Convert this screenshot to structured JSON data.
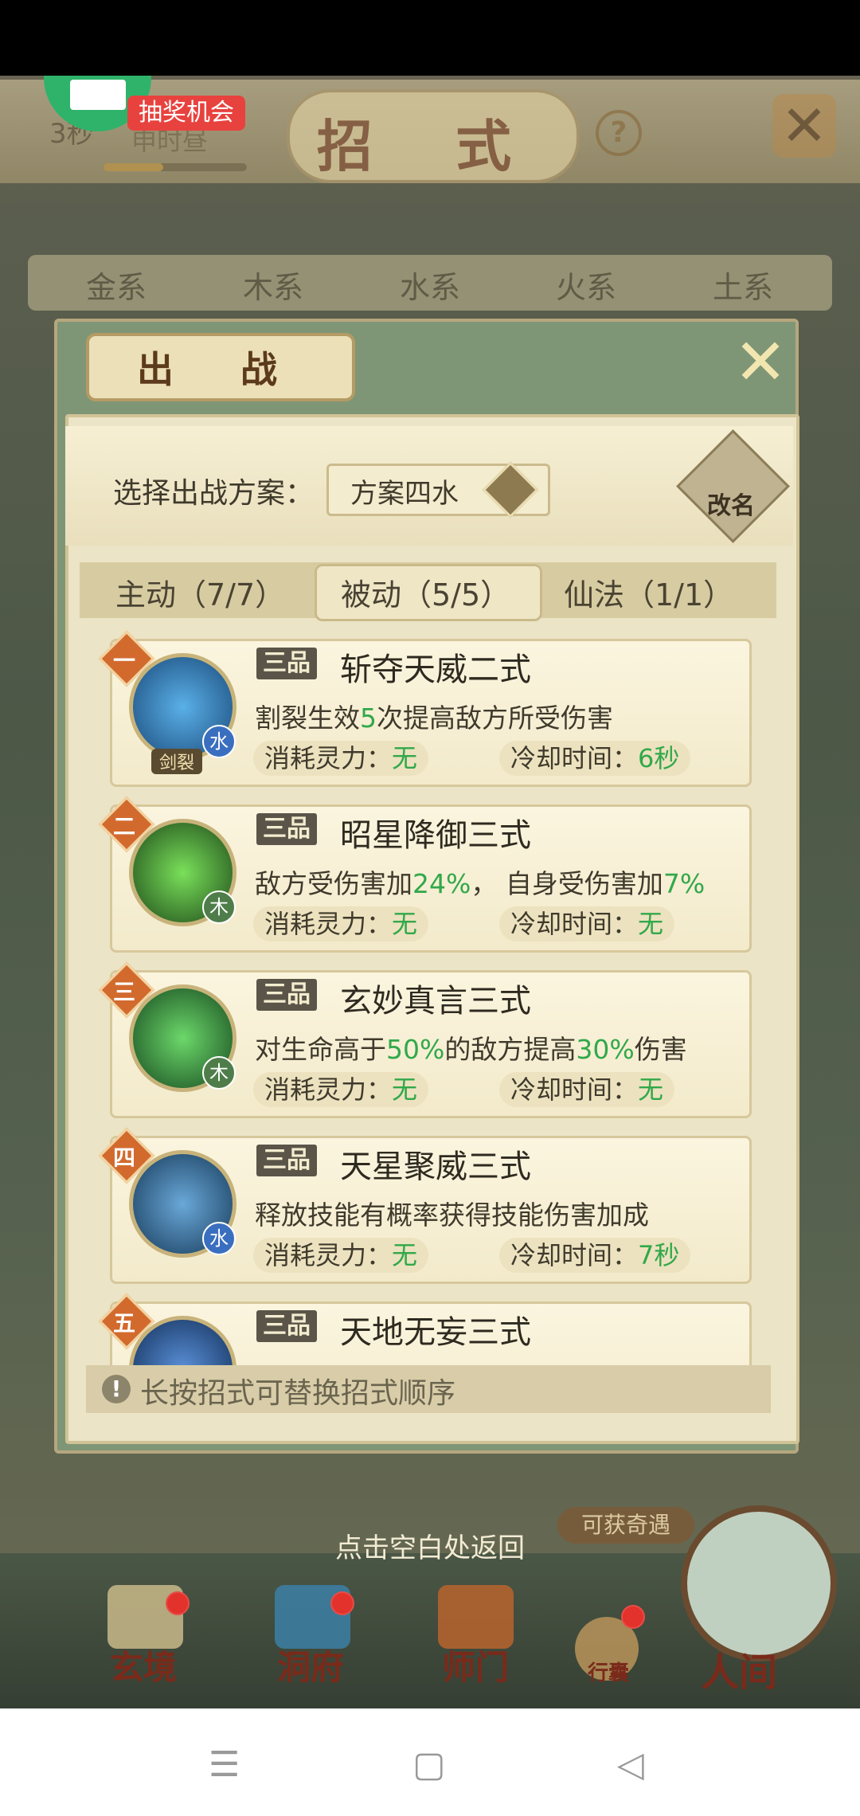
{
  "header": {
    "title": "招 式",
    "timer": "3秒",
    "time_of_day": "申时昼",
    "time_progress": 0.4,
    "lottery_badge": "抽奖机会",
    "help_icon": "?",
    "close_icon": "✕"
  },
  "element_tabs": [
    "金系",
    "木系",
    "水系",
    "火系",
    "土系"
  ],
  "modal": {
    "title": "出 战",
    "close_icon": "✕",
    "plan_label": "选择出战方案：",
    "plan_value": "方案四水",
    "rename_label": "改名",
    "tabs": [
      {
        "label": "主动（7/7）",
        "selected": false
      },
      {
        "label": "被动（5/5）",
        "selected": true
      },
      {
        "label": "仙法（1/1）",
        "selected": false
      }
    ],
    "skills": [
      {
        "rank": "一",
        "grade": "三品",
        "name": "斩夺天威二式",
        "desc_parts": [
          "割裂生效",
          "5",
          "次提高敌方所受伤害"
        ],
        "cost_label": "消耗灵力：",
        "cost_value": "无",
        "cd_label": "冷却时间：",
        "cd_value": "6秒",
        "element": "水",
        "element_color": "#3a6fc0",
        "icon_color": "#2a66a8",
        "tag": "剑裂"
      },
      {
        "rank": "二",
        "grade": "三品",
        "name": "昭星降御三式",
        "desc_parts": [
          "敌方受伤害加",
          "24%",
          "，  自身受伤害加",
          "7%",
          ""
        ],
        "cost_label": "消耗灵力：",
        "cost_value": "无",
        "cd_label": "冷却时间：",
        "cd_value": "无",
        "element": "木",
        "element_color": "#4f7d4a",
        "icon_color": "#2f7a2a",
        "tag": ""
      },
      {
        "rank": "三",
        "grade": "三品",
        "name": "玄妙真言三式",
        "desc_parts": [
          "对生命高于",
          "50%",
          "的敌方提高",
          "30%",
          "伤害"
        ],
        "cost_label": "消耗灵力：",
        "cost_value": "无",
        "cd_label": "冷却时间：",
        "cd_value": "无",
        "element": "木",
        "element_color": "#4f7d4a",
        "icon_color": "#2e8a34",
        "tag": ""
      },
      {
        "rank": "四",
        "grade": "三品",
        "name": "天星聚威三式",
        "desc_parts": [
          "释放技能有概率获得技能伤害加成",
          "",
          "",
          "",
          ""
        ],
        "cost_label": "消耗灵力：",
        "cost_value": "无",
        "cd_label": "冷却时间：",
        "cd_value": "7秒",
        "element": "水",
        "element_color": "#3a6fc0",
        "icon_color": "#2d5f8e",
        "tag": ""
      },
      {
        "rank": "五",
        "grade": "三品",
        "name": "天地无妄三式",
        "desc_parts": [
          "",
          "",
          "",
          "",
          ""
        ],
        "cost_label": "",
        "cost_value": "",
        "cd_label": "",
        "cd_value": "",
        "element": "",
        "element_color": "#3a6fc0",
        "icon_color": "#2a5aa0",
        "tag": ""
      }
    ],
    "hint": "长按招式可替换招式顺序",
    "hint_icon": "!"
  },
  "back_hint": "点击空白处返回",
  "qiyu_badge": "可获奇遇",
  "bottom_nav": [
    {
      "label": "玄境",
      "icon": "scroll-icon"
    },
    {
      "label": "洞府",
      "icon": "pavilion-icon"
    },
    {
      "label": "师门",
      "icon": "banner-icon"
    },
    {
      "label": "行囊",
      "icon": "bag-icon"
    },
    {
      "label": "人间",
      "icon": "world-icon"
    }
  ],
  "system_nav": {
    "menu": "☰",
    "home": "▢",
    "back": "◁"
  }
}
